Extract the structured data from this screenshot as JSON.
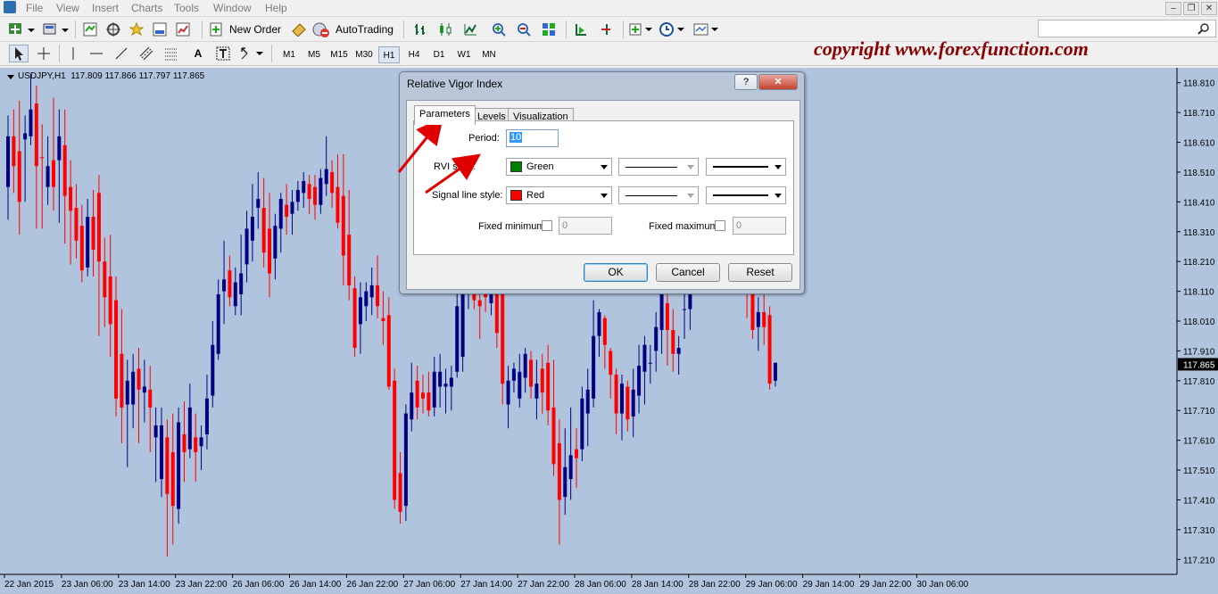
{
  "menu": {
    "file": "File",
    "view": "View",
    "insert": "Insert",
    "charts": "Charts",
    "tools": "Tools",
    "window": "Window",
    "help": "Help"
  },
  "toolbar": {
    "new_order": "New Order",
    "autotrading": "AutoTrading"
  },
  "search": {
    "value": ""
  },
  "timeframes": [
    "M1",
    "M5",
    "M15",
    "M30",
    "H1",
    "H4",
    "D1",
    "W1",
    "MN"
  ],
  "active_timeframe": "H1",
  "watermark": "copyright www.forexfunction.com",
  "chart_header": "USDJPY,H1  117.809 117.866 117.797 117.865",
  "current_price": "117.865",
  "price_axis": [
    "118.810",
    "118.710",
    "118.610",
    "118.510",
    "118.410",
    "118.310",
    "118.210",
    "118.110",
    "118.010",
    "117.910",
    "117.810",
    "117.710",
    "117.610",
    "117.510",
    "117.410",
    "117.310",
    "117.210"
  ],
  "time_axis": [
    "22 Jan 2015",
    "23 Jan 06:00",
    "23 Jan 14:00",
    "23 Jan 22:00",
    "26 Jan 06:00",
    "26 Jan 14:00",
    "26 Jan 22:00",
    "27 Jan 06:00",
    "27 Jan 14:00",
    "27 Jan 22:00",
    "28 Jan 06:00",
    "28 Jan 14:00",
    "28 Jan 22:00",
    "29 Jan 06:00",
    "29 Jan 14:00",
    "29 Jan 22:00",
    "30 Jan 06:00"
  ],
  "colors": {
    "chart_bg": "#b0c4de",
    "bull": "#000080",
    "bear": "#ff0000",
    "arrow": "#e00000",
    "watermark": "#8b0000"
  },
  "dialog": {
    "title": "Relative Vigor Index",
    "help": "?",
    "close": "✕",
    "tabs": [
      "Parameters",
      "Levels",
      "Visualization"
    ],
    "active_tab": "Parameters",
    "period_label": "Period:",
    "period_value": "10",
    "rvi_style_label": "RVI style:",
    "rvi_color": "Green",
    "rvi_color_hex": "#008000",
    "signal_style_label": "Signal line style:",
    "signal_color": "Red",
    "signal_color_hex": "#ff0000",
    "fixed_min_label": "Fixed minimum",
    "fixed_min_value": "0",
    "fixed_max_label": "Fixed maximum",
    "fixed_max_value": "0",
    "ok": "OK",
    "cancel": "Cancel",
    "reset": "Reset"
  },
  "chart_data": {
    "type": "candlestick",
    "symbol": "USDJPY",
    "timeframe": "H1",
    "ylim": [
      117.16,
      118.86
    ],
    "candles": [
      [
        "b",
        118.46,
        118.63,
        118.7,
        118.35
      ],
      [
        "r",
        118.63,
        118.53,
        118.72,
        118.44
      ],
      [
        "r",
        118.58,
        118.41,
        118.75,
        118.3
      ],
      [
        "b",
        118.62,
        118.64,
        118.7,
        118.41
      ],
      [
        "b",
        118.63,
        118.72,
        118.84,
        118.6
      ],
      [
        "r",
        118.74,
        118.53,
        118.8,
        118.32
      ],
      [
        "r",
        118.56,
        118.56,
        118.67,
        118.32
      ],
      [
        "b",
        118.46,
        118.53,
        118.63,
        118.4
      ],
      [
        "r",
        118.55,
        118.46,
        118.76,
        118.38
      ],
      [
        "b",
        118.55,
        118.63,
        118.72,
        118.34
      ],
      [
        "r",
        118.6,
        118.43,
        118.72,
        118.27
      ],
      [
        "r",
        118.46,
        118.38,
        118.55,
        118.2
      ],
      [
        "r",
        118.39,
        118.28,
        118.47,
        118.22
      ],
      [
        "r",
        118.33,
        118.18,
        118.4,
        118.14
      ],
      [
        "b",
        118.19,
        118.36,
        118.42,
        118.16
      ],
      [
        "r",
        118.36,
        118.25,
        118.45,
        118.16
      ],
      [
        "r",
        118.44,
        118.21,
        118.5,
        117.96
      ],
      [
        "r",
        118.21,
        118.09,
        118.29,
        117.99
      ],
      [
        "r",
        118.16,
        118.0,
        118.3,
        117.89
      ],
      [
        "r",
        118.08,
        117.75,
        118.16,
        117.69
      ],
      [
        "r",
        117.9,
        117.72,
        118.05,
        117.6
      ],
      [
        "b",
        117.73,
        117.81,
        117.88,
        117.52
      ],
      [
        "b",
        117.73,
        117.84,
        117.9,
        117.65
      ],
      [
        "r",
        117.85,
        117.78,
        117.92,
        117.6
      ],
      [
        "b",
        117.77,
        117.79,
        117.88,
        117.67
      ],
      [
        "r",
        117.78,
        117.72,
        117.86,
        117.57
      ],
      [
        "b",
        117.66,
        117.62,
        117.72,
        117.47
      ],
      [
        "b",
        117.48,
        117.66,
        117.72,
        117.42
      ],
      [
        "r",
        117.62,
        117.43,
        117.68,
        117.22
      ],
      [
        "r",
        117.57,
        117.39,
        117.7,
        117.26
      ],
      [
        "b",
        117.38,
        117.67,
        117.72,
        117.33
      ],
      [
        "r",
        117.63,
        117.57,
        117.74,
        117.47
      ],
      [
        "b",
        117.58,
        117.72,
        117.8,
        117.55
      ],
      [
        "r",
        117.62,
        117.57,
        117.7,
        117.47
      ],
      [
        "b",
        117.59,
        117.62,
        117.66,
        117.51
      ],
      [
        "b",
        117.63,
        117.75,
        117.83,
        117.58
      ],
      [
        "b",
        117.76,
        117.93,
        118.01,
        117.72
      ],
      [
        "b",
        117.9,
        118.1,
        118.15,
        117.88
      ],
      [
        "b",
        118.11,
        118.15,
        118.28,
        118.0
      ],
      [
        "r",
        118.09,
        118.18,
        118.23,
        118.06
      ],
      [
        "b",
        118.06,
        118.14,
        118.19,
        118.03
      ],
      [
        "b",
        118.1,
        118.17,
        118.3,
        118.03
      ],
      [
        "b",
        118.2,
        118.32,
        118.38,
        118.14
      ],
      [
        "b",
        118.28,
        118.36,
        118.47,
        118.21
      ],
      [
        "b",
        118.39,
        118.42,
        118.51,
        118.32
      ],
      [
        "r",
        118.39,
        118.24,
        118.49,
        118.19
      ],
      [
        "r",
        118.32,
        118.17,
        118.44,
        118.09
      ],
      [
        "b",
        118.22,
        118.33,
        118.37,
        118.15
      ],
      [
        "b",
        118.32,
        118.42,
        118.44,
        118.24
      ],
      [
        "r",
        118.4,
        118.36,
        118.47,
        118.3
      ],
      [
        "b",
        118.37,
        118.41,
        118.45,
        118.3
      ],
      [
        "b",
        118.41,
        118.45,
        118.48,
        118.38
      ],
      [
        "b",
        118.44,
        118.48,
        118.51,
        118.39
      ],
      [
        "r",
        118.47,
        118.42,
        118.5,
        118.37
      ],
      [
        "r",
        118.46,
        118.4,
        118.5,
        118.35
      ],
      [
        "b",
        118.4,
        118.49,
        118.52,
        118.37
      ],
      [
        "b",
        118.47,
        118.52,
        118.63,
        118.43
      ],
      [
        "r",
        118.51,
        118.44,
        118.55,
        118.39
      ],
      [
        "r",
        118.46,
        118.34,
        118.57,
        118.32
      ],
      [
        "r",
        118.43,
        118.23,
        118.57,
        118.13
      ],
      [
        "r",
        118.3,
        118.13,
        118.45,
        118.08
      ],
      [
        "r",
        118.12,
        117.92,
        118.16,
        117.89
      ],
      [
        "b",
        118.0,
        118.09,
        118.14,
        117.9
      ],
      [
        "b",
        118.06,
        118.11,
        118.14,
        118.01
      ],
      [
        "b",
        118.09,
        118.13,
        118.19,
        118.03
      ],
      [
        "r",
        118.13,
        118.06,
        118.23,
        118.02
      ],
      [
        "r",
        118.02,
        118.01,
        118.11,
        117.93
      ],
      [
        "r",
        118.03,
        117.79,
        118.09,
        117.78
      ],
      [
        "r",
        117.81,
        117.41,
        117.85,
        117.38
      ],
      [
        "r",
        117.5,
        117.37,
        117.57,
        117.33
      ],
      [
        "b",
        117.39,
        117.7,
        117.73,
        117.34
      ],
      [
        "b",
        117.68,
        117.77,
        117.87,
        117.64
      ],
      [
        "r",
        117.81,
        117.72,
        117.86,
        117.68
      ],
      [
        "r",
        117.77,
        117.75,
        117.83,
        117.7
      ],
      [
        "r",
        117.77,
        117.71,
        117.84,
        117.69
      ],
      [
        "b",
        117.72,
        117.84,
        117.89,
        117.69
      ],
      [
        "b",
        117.79,
        117.84,
        117.9,
        117.72
      ],
      [
        "b",
        117.79,
        117.8,
        117.85,
        117.7
      ],
      [
        "b",
        117.79,
        117.82,
        117.86,
        117.71
      ],
      [
        "b",
        117.84,
        118.06,
        118.15,
        117.82
      ],
      [
        "b",
        117.89,
        118.11,
        118.16,
        117.84
      ],
      [
        "b",
        118.11,
        118.1,
        118.15,
        118.05
      ],
      [
        "r",
        118.12,
        118.08,
        118.17,
        118.05
      ],
      [
        "r",
        118.08,
        118.06,
        118.13,
        117.95
      ],
      [
        "r",
        118.1,
        118.09,
        118.16,
        118.04
      ],
      [
        "b",
        118.07,
        118.13,
        118.17,
        118.03
      ],
      [
        "r",
        118.11,
        117.97,
        118.14,
        117.92
      ],
      [
        "r",
        118.13,
        117.8,
        118.16,
        117.73
      ],
      [
        "b",
        117.73,
        117.81,
        117.86,
        117.65
      ],
      [
        "b",
        117.81,
        117.85,
        117.87,
        117.77
      ],
      [
        "b",
        117.75,
        117.84,
        117.9,
        117.72
      ],
      [
        "b",
        117.82,
        117.9,
        117.92,
        117.77
      ],
      [
        "r",
        117.88,
        117.79,
        117.91,
        117.75
      ],
      [
        "b",
        117.75,
        117.8,
        117.88,
        117.68
      ],
      [
        "r",
        117.85,
        117.77,
        117.9,
        117.7
      ],
      [
        "r",
        117.87,
        117.71,
        117.93,
        117.66
      ],
      [
        "r",
        117.72,
        117.53,
        117.88,
        117.49
      ],
      [
        "r",
        117.6,
        117.41,
        117.68,
        117.26
      ],
      [
        "b",
        117.42,
        117.52,
        117.65,
        117.36
      ],
      [
        "b",
        117.48,
        117.56,
        117.72,
        117.41
      ],
      [
        "r",
        117.55,
        117.58,
        117.65,
        117.45
      ],
      [
        "b",
        117.58,
        117.75,
        117.79,
        117.54
      ],
      [
        "b",
        117.7,
        117.78,
        117.85,
        117.59
      ],
      [
        "b",
        117.75,
        117.96,
        118.08,
        117.72
      ],
      [
        "b",
        117.96,
        118.04,
        118.05,
        117.89
      ],
      [
        "r",
        118.02,
        117.93,
        118.03,
        117.85
      ],
      [
        "r",
        117.91,
        117.83,
        117.92,
        117.75
      ],
      [
        "r",
        117.83,
        117.7,
        117.85,
        117.63
      ],
      [
        "b",
        117.7,
        117.8,
        117.83,
        117.61
      ],
      [
        "r",
        117.79,
        117.68,
        117.81,
        117.64
      ],
      [
        "b",
        117.69,
        117.78,
        117.85,
        117.62
      ],
      [
        "b",
        117.76,
        117.86,
        117.93,
        117.7
      ],
      [
        "b",
        117.84,
        117.93,
        117.96,
        117.73
      ],
      [
        "b",
        117.87,
        117.87,
        117.93,
        117.8
      ],
      [
        "b",
        117.91,
        117.99,
        118.04,
        117.84
      ],
      [
        "b",
        117.98,
        118.1,
        118.15,
        117.9
      ],
      [
        "r",
        118.07,
        117.98,
        118.17,
        117.86
      ],
      [
        "r",
        117.98,
        117.9,
        118.05,
        117.84
      ],
      [
        "b",
        117.9,
        117.92,
        117.96,
        117.83
      ],
      [
        "b",
        118.05,
        118.05,
        118.12,
        117.95
      ],
      [
        "b",
        118.05,
        118.29,
        118.32,
        117.98
      ],
      [
        "b",
        118.26,
        118.32,
        118.4,
        118.17
      ],
      [
        "b",
        118.35,
        118.42,
        118.47,
        118.27
      ],
      [
        "r",
        118.41,
        118.4,
        118.45,
        118.34
      ],
      [
        "r",
        118.42,
        118.35,
        118.44,
        118.27
      ],
      [
        "r",
        118.35,
        118.3,
        118.38,
        118.2
      ],
      [
        "r",
        118.33,
        118.28,
        118.37,
        118.24
      ],
      [
        "b",
        118.27,
        118.33,
        118.43,
        118.21
      ],
      [
        "r",
        118.33,
        118.27,
        118.38,
        118.18
      ],
      [
        "r",
        118.26,
        118.21,
        118.28,
        118.11
      ],
      [
        "r",
        118.24,
        118.11,
        118.26,
        118.02
      ],
      [
        "r",
        118.13,
        117.98,
        118.17,
        117.95
      ],
      [
        "b",
        117.99,
        118.04,
        118.09,
        117.91
      ],
      [
        "r",
        118.04,
        117.99,
        118.14,
        117.93
      ],
      [
        "r",
        118.03,
        117.8,
        118.06,
        117.78
      ],
      [
        "b",
        117.81,
        117.87,
        117.87,
        117.79
      ]
    ],
    "annotations": [
      "arrow to Parameters tab",
      "arrow to Period field",
      "arrow from chart to dialog"
    ]
  }
}
